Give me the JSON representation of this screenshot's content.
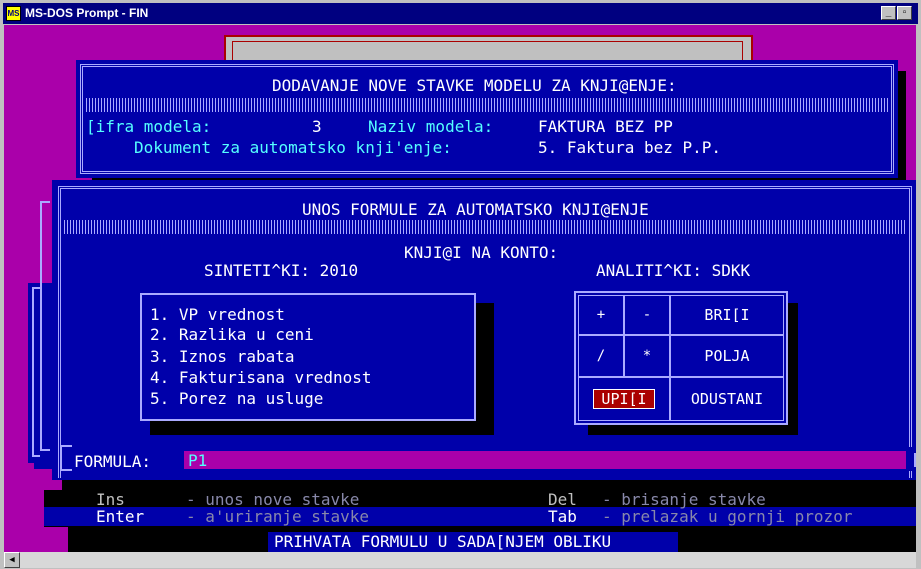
{
  "window": {
    "title": "MS-DOS Prompt - FIN",
    "icon_label": "MS",
    "minimize_glyph": "_",
    "restore_glyph": "▫"
  },
  "top_panel": {
    "header": "DODAVANJE NOVE STAVKE MODELU ZA KNJI@ENJE:",
    "sifra_label": "[ifra modela:",
    "sifra_value": "3",
    "naziv_label": "Naziv modela:",
    "naziv_value": "FAKTURA BEZ PP",
    "dokument_label": "Dokument za automatsko knji'enje:",
    "dokument_value": "5. Faktura bez P.P."
  },
  "formula_panel": {
    "header": "UNOS FORMULE ZA AUTOMATSKO KNJI@ENJE",
    "konto_label": "KNJI@I NA KONTO:",
    "sintetic": "SINTETI^KI: 2010",
    "analitic": "ANALITI^KI: SDKK",
    "fields": [
      "1. VP vrednost",
      "2. Razlika u ceni",
      "3. Iznos rabata",
      "4. Fakturisana vrednost",
      "5. Porez na usluge"
    ],
    "keypad": {
      "plus": "+",
      "minus": "-",
      "brisi": "BRI[I",
      "divide": "/",
      "multiply": "*",
      "polja": "POLJA",
      "upisi": "UPI[I",
      "odustani": "ODUSTANI"
    },
    "formula_label": "FORMULA:",
    "formula_value": "P1"
  },
  "footer": {
    "ins_key": "Ins",
    "ins_desc": "- unos nove stavke",
    "del_key": "Del",
    "del_desc": "- brisanje stavke",
    "enter_key": "Enter",
    "enter_desc": "- a'uriranje stavke",
    "tab_key": "Tab",
    "tab_desc": "- prelazak u gornji prozor",
    "status": "PRIHVATA FORMULU U SADA[NJEM OBLIKU"
  },
  "colors": {
    "dos_blue": "#0000aa",
    "dos_magenta": "#aa00aa",
    "dos_cyan": "#55ffff",
    "dos_red": "#aa0000",
    "title_blue": "#000080"
  }
}
